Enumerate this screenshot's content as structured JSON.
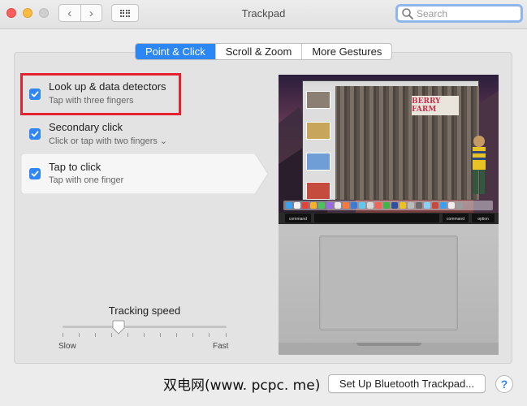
{
  "window": {
    "title": "Trackpad"
  },
  "search": {
    "placeholder": "Search"
  },
  "tabs": [
    {
      "label": "Point & Click",
      "active": true
    },
    {
      "label": "Scroll & Zoom",
      "active": false
    },
    {
      "label": "More Gestures",
      "active": false
    }
  ],
  "options": [
    {
      "title": "Look up & data detectors",
      "subtitle": "Tap with three fingers",
      "checked": true,
      "highlighted": true
    },
    {
      "title": "Secondary click",
      "subtitle": "Click or tap with two fingers ⌄",
      "checked": true,
      "highlighted": false
    },
    {
      "title": "Tap to click",
      "subtitle": "Tap with one finger",
      "checked": true,
      "selected": true
    }
  ],
  "tracking": {
    "label": "Tracking speed",
    "slow": "Slow",
    "fast": "Fast",
    "value_fraction": 0.33
  },
  "preview": {
    "banner_text": "BERRY FARM",
    "keys": {
      "left": "command",
      "right": "command",
      "option": "option"
    }
  },
  "footer": {
    "bluetooth_button": "Set Up Bluetooth Trackpad...",
    "help_label": "?",
    "watermark": "双电网(www. pcpc. me)"
  },
  "colors": {
    "accent": "#2c87f5",
    "highlight_box": "#e5232f"
  }
}
